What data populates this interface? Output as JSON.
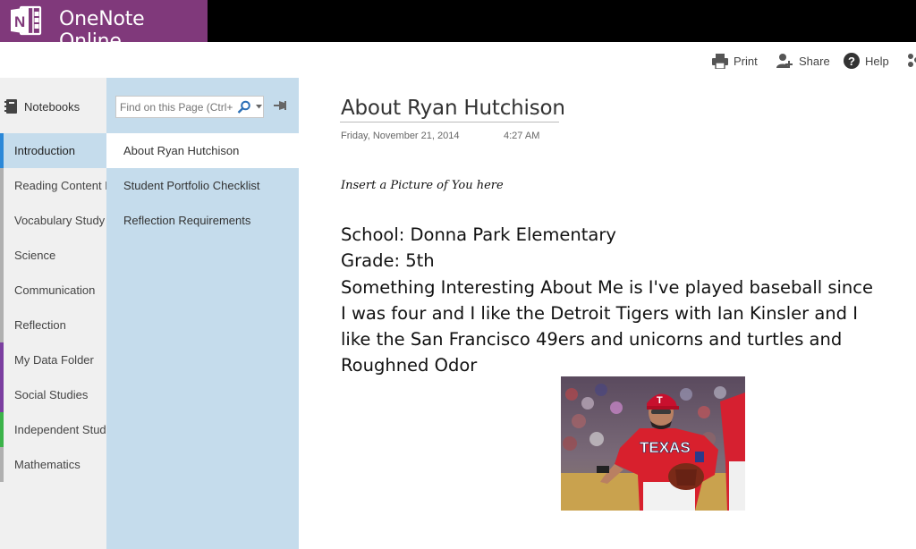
{
  "app": {
    "name": "OneNote Online"
  },
  "commands": [
    {
      "label": "Print",
      "icon": "printer-icon"
    },
    {
      "label": "Share",
      "icon": "share-person-icon"
    },
    {
      "label": "Help",
      "icon": "help-icon"
    }
  ],
  "notebooks": {
    "label": "Notebooks"
  },
  "sections": [
    {
      "label": "Introduction",
      "color": "#2b88d8",
      "selected": true
    },
    {
      "label": "Reading Content I",
      "color": "#b0b0b0"
    },
    {
      "label": "Vocabulary Study",
      "color": "#b0b0b0"
    },
    {
      "label": "Science",
      "color": "#b0b0b0"
    },
    {
      "label": "Communication",
      "color": "#b0b0b0"
    },
    {
      "label": "Reflection",
      "color": "#b0b0b0"
    },
    {
      "label": "My Data Folder",
      "color": "#7b3fa0"
    },
    {
      "label": "Social Studies",
      "color": "#7b3fa0"
    },
    {
      "label": "Independent Stud",
      "color": "#3cb34a"
    },
    {
      "label": "Mathematics",
      "color": "#b0b0b0"
    }
  ],
  "search": {
    "placeholder": "Find on this Page (Ctrl+F)"
  },
  "pages": [
    {
      "label": "About Ryan Hutchison",
      "selected": true
    },
    {
      "label": "Student Portfolio Checklist"
    },
    {
      "label": "Reflection Requirements"
    }
  ],
  "page": {
    "title": "About Ryan Hutchison",
    "date": "Friday, November 21, 2014",
    "time": "4:27 AM",
    "insert_note": "Insert a Picture of You here",
    "lines": [
      "School:  Donna Park Elementary",
      "Grade: 5th",
      "Something Interesting About Me is I've played baseball since",
      "I was four and I like the Detroit Tigers with Ian Kinsler and I",
      "like the San Francisco 49ers and unicorns and turtles and",
      "Roughned Odor"
    ],
    "photo": {
      "jersey_text": "TEXAS",
      "cap_letter": "T"
    }
  },
  "colors": {
    "brand": "#80397b",
    "pane_blue": "#c5dcec",
    "sections_bg": "#f0f0f0"
  }
}
